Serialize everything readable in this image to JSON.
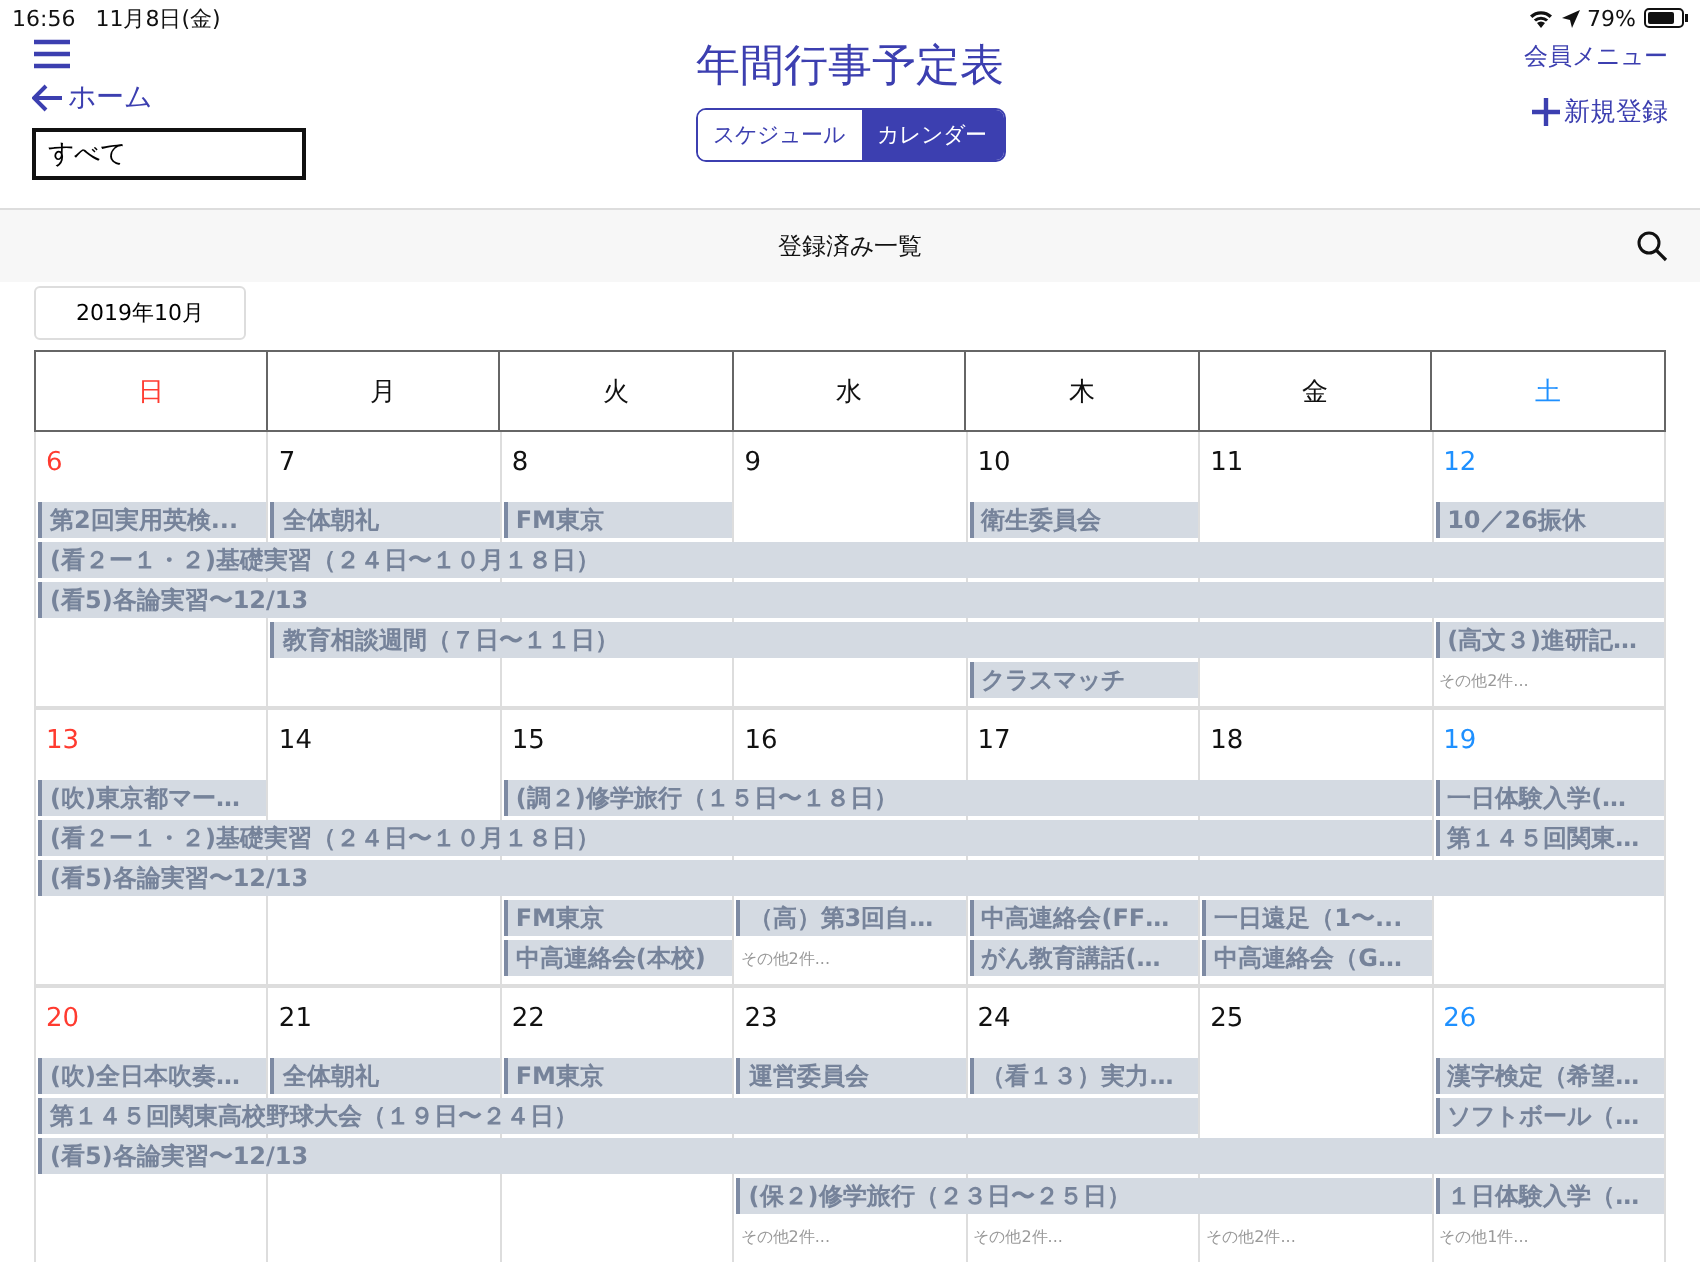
{
  "status_bar": {
    "time": "16:56",
    "date": "11月8日(金)",
    "battery": "79%"
  },
  "header": {
    "title": "年間行事予定表",
    "back": "ホーム",
    "filter": {
      "value": "すべて"
    },
    "member_menu": "会員メニュー",
    "new_entry": "新規登録",
    "tabs": [
      {
        "label": "スケジュール",
        "selected": false
      },
      {
        "label": "カレンダー",
        "selected": true
      }
    ]
  },
  "list_bar": {
    "title": "登録済み一覧"
  },
  "month": "2019年10月",
  "weekdays": [
    {
      "label": "日",
      "kind": "sunday"
    },
    {
      "label": "月",
      "kind": "weekday"
    },
    {
      "label": "火",
      "kind": "weekday"
    },
    {
      "label": "水",
      "kind": "weekday"
    },
    {
      "label": "木",
      "kind": "weekday"
    },
    {
      "label": "金",
      "kind": "weekday"
    },
    {
      "label": "土",
      "kind": "saturday"
    }
  ],
  "weeks": [
    {
      "days": [
        {
          "date": "6",
          "kind": "sunday"
        },
        {
          "date": "7",
          "kind": "weekday"
        },
        {
          "date": "8",
          "kind": "weekday"
        },
        {
          "date": "9",
          "kind": "weekday"
        },
        {
          "date": "10",
          "kind": "weekday"
        },
        {
          "date": "11",
          "kind": "weekday"
        },
        {
          "date": "12",
          "kind": "saturday"
        }
      ],
      "lanes": [
        [
          {
            "kind": "event",
            "title": "第2回実用英検..."
          },
          {
            "kind": "event",
            "title": "全体朝礼"
          },
          {
            "kind": "event",
            "title": "FM東京"
          },
          {
            "kind": "empty"
          },
          {
            "kind": "event",
            "title": "衛生委員会"
          },
          {
            "kind": "empty"
          },
          {
            "kind": "event",
            "title": "10／26振休"
          }
        ],
        [
          {
            "kind": "event",
            "title": "(看２ー１・２)基礎実習（２４日〜１０月１８日）"
          },
          {
            "kind": "cont"
          },
          {
            "kind": "cont"
          },
          {
            "kind": "cont"
          },
          {
            "kind": "cont"
          },
          {
            "kind": "cont"
          },
          {
            "kind": "cont"
          }
        ],
        [
          {
            "kind": "event",
            "title": "(看5)各論実習〜12/13"
          },
          {
            "kind": "cont"
          },
          {
            "kind": "cont"
          },
          {
            "kind": "cont"
          },
          {
            "kind": "cont"
          },
          {
            "kind": "cont"
          },
          {
            "kind": "cont"
          }
        ],
        [
          {
            "kind": "empty"
          },
          {
            "kind": "event",
            "title": "教育相談週間（７日〜１１日）"
          },
          {
            "kind": "cont"
          },
          {
            "kind": "cont"
          },
          {
            "kind": "cont"
          },
          {
            "kind": "cont"
          },
          {
            "kind": "event",
            "title": "(高文３)進研記…"
          }
        ],
        [
          {
            "kind": "empty"
          },
          {
            "kind": "empty"
          },
          {
            "kind": "empty"
          },
          {
            "kind": "empty"
          },
          {
            "kind": "event",
            "title": "クラスマッチ"
          },
          {
            "kind": "empty"
          },
          {
            "kind": "more",
            "text": "その他2件..."
          }
        ]
      ]
    },
    {
      "days": [
        {
          "date": "13",
          "kind": "sunday"
        },
        {
          "date": "14",
          "kind": "weekday"
        },
        {
          "date": "15",
          "kind": "weekday"
        },
        {
          "date": "16",
          "kind": "weekday"
        },
        {
          "date": "17",
          "kind": "weekday"
        },
        {
          "date": "18",
          "kind": "weekday"
        },
        {
          "date": "19",
          "kind": "saturday"
        }
      ],
      "lanes": [
        [
          {
            "kind": "event",
            "title": "(吹)東京都マー…"
          },
          {
            "kind": "empty"
          },
          {
            "kind": "event",
            "title": "(調２)修学旅行（１５日〜１８日）"
          },
          {
            "kind": "cont"
          },
          {
            "kind": "cont"
          },
          {
            "kind": "cont"
          },
          {
            "kind": "event",
            "title": "一日体験入学(…"
          }
        ],
        [
          {
            "kind": "event",
            "title": "(看２ー１・２)基礎実習（２４日〜１０月１８日）"
          },
          {
            "kind": "cont"
          },
          {
            "kind": "cont"
          },
          {
            "kind": "cont"
          },
          {
            "kind": "cont"
          },
          {
            "kind": "cont"
          },
          {
            "kind": "event",
            "title": "第１４５回関東…"
          }
        ],
        [
          {
            "kind": "event",
            "title": "(看5)各論実習〜12/13"
          },
          {
            "kind": "cont"
          },
          {
            "kind": "cont"
          },
          {
            "kind": "cont"
          },
          {
            "kind": "cont"
          },
          {
            "kind": "cont"
          },
          {
            "kind": "cont"
          }
        ],
        [
          {
            "kind": "empty"
          },
          {
            "kind": "empty"
          },
          {
            "kind": "event",
            "title": "FM東京"
          },
          {
            "kind": "event",
            "title": "（高）第3回自…"
          },
          {
            "kind": "event",
            "title": "中高連絡会(FF…"
          },
          {
            "kind": "event",
            "title": "一日遠足（1〜..."
          },
          {
            "kind": "empty"
          }
        ],
        [
          {
            "kind": "empty"
          },
          {
            "kind": "empty"
          },
          {
            "kind": "event",
            "title": "中高連絡会(本校)"
          },
          {
            "kind": "more",
            "text": "その他2件..."
          },
          {
            "kind": "event",
            "title": "がん教育講話(…"
          },
          {
            "kind": "event",
            "title": "中高連絡会（G…"
          },
          {
            "kind": "empty"
          }
        ]
      ]
    },
    {
      "days": [
        {
          "date": "20",
          "kind": "sunday"
        },
        {
          "date": "21",
          "kind": "weekday"
        },
        {
          "date": "22",
          "kind": "weekday"
        },
        {
          "date": "23",
          "kind": "weekday"
        },
        {
          "date": "24",
          "kind": "weekday"
        },
        {
          "date": "25",
          "kind": "weekday"
        },
        {
          "date": "26",
          "kind": "saturday"
        }
      ],
      "lanes": [
        [
          {
            "kind": "event",
            "title": "(吹)全日本吹奏…"
          },
          {
            "kind": "event",
            "title": "全体朝礼"
          },
          {
            "kind": "event",
            "title": "FM東京"
          },
          {
            "kind": "event",
            "title": "運営委員会"
          },
          {
            "kind": "event",
            "title": "（看１３）実力…"
          },
          {
            "kind": "empty"
          },
          {
            "kind": "event",
            "title": "漢字検定（希望…"
          }
        ],
        [
          {
            "kind": "event",
            "title": "第１４５回関東高校野球大会（１９日〜２４日）"
          },
          {
            "kind": "cont"
          },
          {
            "kind": "cont"
          },
          {
            "kind": "cont"
          },
          {
            "kind": "cont"
          },
          {
            "kind": "empty"
          },
          {
            "kind": "event",
            "title": "ソフトボール（…"
          }
        ],
        [
          {
            "kind": "event",
            "title": "(看5)各論実習〜12/13"
          },
          {
            "kind": "cont"
          },
          {
            "kind": "cont"
          },
          {
            "kind": "cont"
          },
          {
            "kind": "cont"
          },
          {
            "kind": "cont"
          },
          {
            "kind": "cont"
          }
        ],
        [
          {
            "kind": "empty"
          },
          {
            "kind": "empty"
          },
          {
            "kind": "empty"
          },
          {
            "kind": "event",
            "title": "(保２)修学旅行（２３日〜２５日）"
          },
          {
            "kind": "cont"
          },
          {
            "kind": "cont"
          },
          {
            "kind": "event",
            "title": "１日体験入学（…"
          }
        ],
        [
          {
            "kind": "empty"
          },
          {
            "kind": "empty"
          },
          {
            "kind": "empty"
          },
          {
            "kind": "more",
            "text": "その他2件..."
          },
          {
            "kind": "more",
            "text": "その他2件..."
          },
          {
            "kind": "more",
            "text": "その他2件..."
          },
          {
            "kind": "more",
            "text": "その他1件..."
          }
        ]
      ]
    }
  ]
}
